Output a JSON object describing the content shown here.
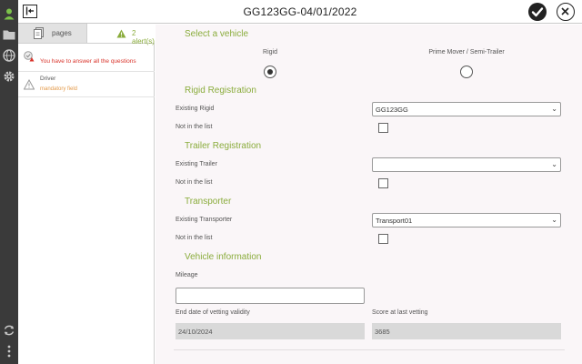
{
  "window": {
    "title": "GG123GG-04/01/2022"
  },
  "colors": {
    "accent": "#8aac3c",
    "warning": "#e39a4a",
    "error": "#d9342b",
    "rail": "#3a3a3a"
  },
  "rail": {
    "icons": [
      "user-icon",
      "folder-icon",
      "globe-icon",
      "gear-icon",
      "sync-icon",
      "more-icon"
    ]
  },
  "panel": {
    "tabs": {
      "pages": "pages",
      "alerts": "2 alert(s)"
    },
    "alerts": [
      {
        "title": "You have to answer all the questions",
        "subtitle": ""
      },
      {
        "title": "Driver",
        "subtitle": "mandatory field"
      }
    ]
  },
  "form": {
    "select_vehicle": {
      "heading": "Select a vehicle",
      "options": [
        {
          "label": "Rigid",
          "selected": true
        },
        {
          "label": "Prime Mover / Semi-Trailer",
          "selected": false
        }
      ]
    },
    "rigid": {
      "heading": "Rigid Registration",
      "existing_label": "Existing Rigid",
      "existing_value": "GG123GG",
      "not_in_list_label": "Not in the list"
    },
    "trailer": {
      "heading": "Trailer Registration",
      "existing_label": "Existing Trailer",
      "existing_value": "",
      "not_in_list_label": "Not in the list"
    },
    "transporter": {
      "heading": "Transporter",
      "existing_label": "Existing Transporter",
      "existing_value": "Transport01",
      "not_in_list_label": "Not in the list"
    },
    "vehicle_info": {
      "heading": "Vehicle information",
      "mileage_label": "Mileage",
      "mileage_value": "",
      "end_date_label": "End date of vetting validity",
      "end_date_value": "24/10/2024",
      "score_label": "Score at last vetting",
      "score_value": "3685"
    }
  }
}
